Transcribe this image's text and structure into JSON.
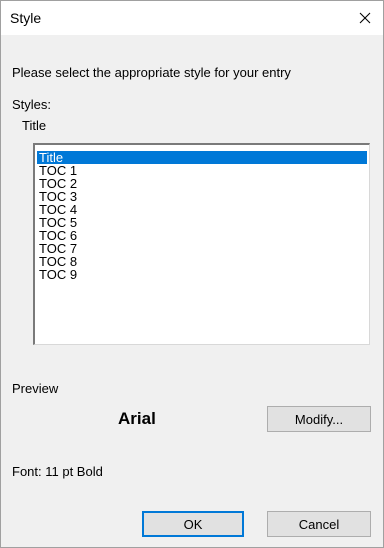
{
  "window": {
    "title": "Style",
    "close_icon": "close-icon"
  },
  "instruction": "Please select the appropriate style for your entry",
  "styles_section": {
    "label": "Styles:",
    "current_value": "Title",
    "items": [
      "Title",
      "TOC 1",
      "TOC 2",
      "TOC 3",
      "TOC 4",
      "TOC 5",
      "TOC 6",
      "TOC 7",
      "TOC 8",
      "TOC 9"
    ],
    "selected": "Title"
  },
  "preview": {
    "label": "Preview",
    "font_sample": "Arial",
    "modify_label": "Modify..."
  },
  "font_info": "Font: 11 pt Bold",
  "buttons": {
    "ok_label": "OK",
    "cancel_label": "Cancel"
  },
  "colors": {
    "selection": "#0078d7",
    "dialog_background": "#f0f0f0",
    "default_button_border": "#0078d7"
  }
}
